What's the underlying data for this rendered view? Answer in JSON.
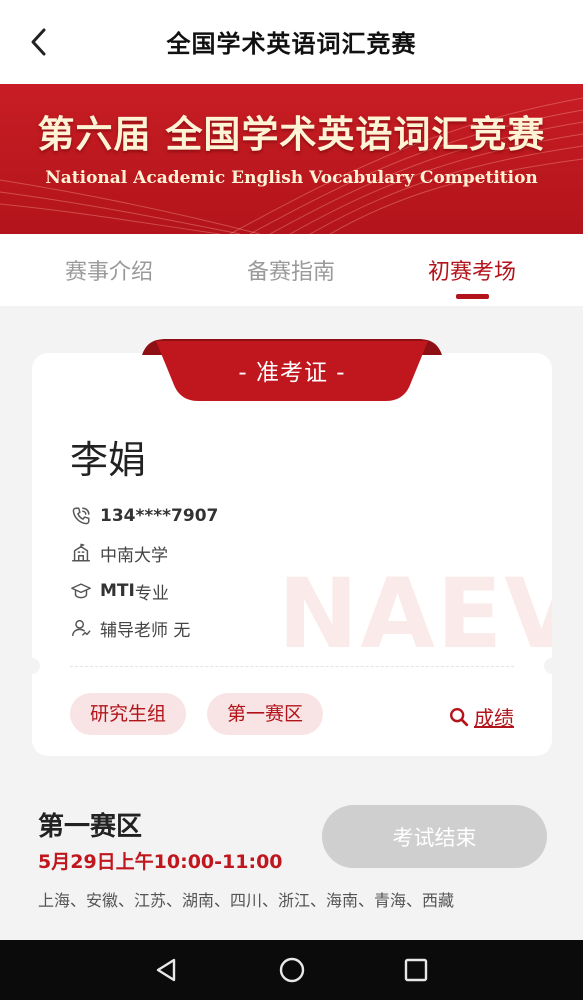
{
  "header": {
    "title": "全国学术英语词汇竞赛",
    "back_icon": "chevron-left-icon"
  },
  "banner": {
    "title": "第六届 全国学术英语词汇竞赛",
    "subtitle": "National Academic English Vocabulary Competition"
  },
  "tabs": [
    {
      "label": "赛事介绍",
      "active": false
    },
    {
      "label": "备赛指南",
      "active": false
    },
    {
      "label": "初赛考场",
      "active": true
    }
  ],
  "ticket": {
    "ribbon_label": "- 准考证 -",
    "name": "李娟",
    "phone": "134****7907",
    "school": "中南大学",
    "major_prefix": "MTI",
    "major_suffix": "专业",
    "tutor": "辅导老师 无",
    "watermark": "NAEV",
    "tags": [
      "研究生组",
      "第一赛区"
    ],
    "score_label": "成绩"
  },
  "exam": {
    "region_title": "第一赛区",
    "time": "5月29日上午10:00-11:00",
    "regions": "上海、安徽、江苏、湖南、四川、浙江、海南、青海、西藏",
    "status_button": "考试结束"
  },
  "colors": {
    "brand_red": "#b3141b",
    "pill_bg": "#f8e4e4",
    "disabled_button": "#cfcfcf"
  },
  "system_nav": {
    "icons": [
      "back-triangle-icon",
      "home-circle-icon",
      "recents-square-icon"
    ]
  }
}
